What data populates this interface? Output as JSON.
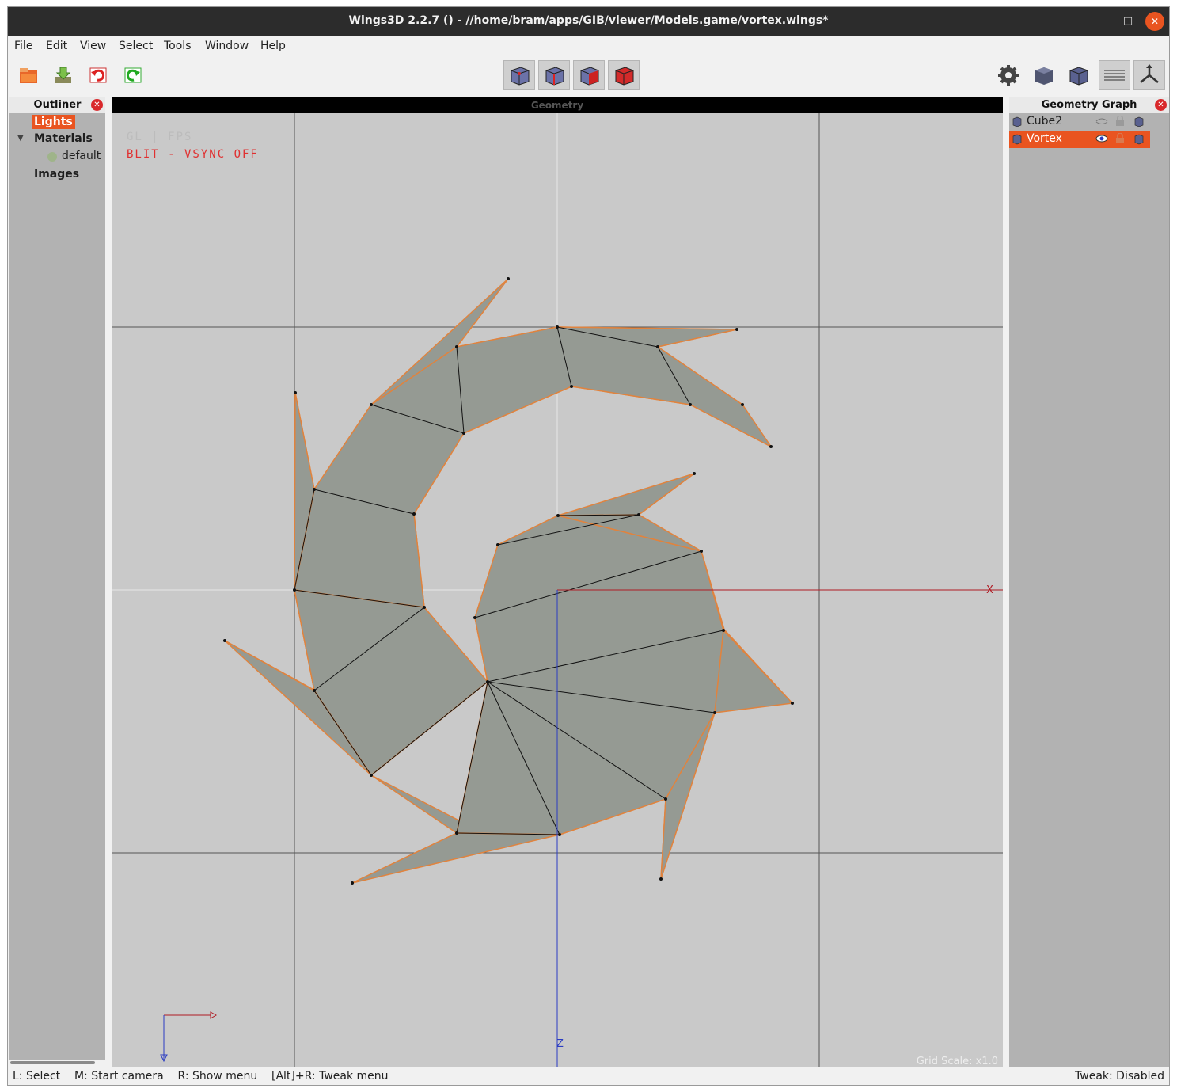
{
  "window": {
    "title": "Wings3D 2.2.7 () - //home/bram/apps/GIB/viewer/Models.game/vortex.wings*",
    "minimize_glyph": "–",
    "maximize_glyph": "□",
    "close_glyph": "✕"
  },
  "menu": [
    "File",
    "Edit",
    "View",
    "Select",
    "Tools",
    "Window",
    "Help"
  ],
  "toolbar": {
    "left_icons": [
      "open-folder-icon",
      "save-icon",
      "undo-icon",
      "redo-icon"
    ],
    "mode_icons": [
      "vertex-mode-icon",
      "edge-mode-icon",
      "face-mode-icon",
      "body-mode-icon"
    ],
    "right_icons": [
      "settings-gear-icon",
      "smooth-shading-icon",
      "flat-shading-icon",
      "groundplane-icon",
      "axes-icon"
    ]
  },
  "outliner": {
    "title": "Outliner",
    "items": [
      {
        "label": "Lights",
        "selected": true
      },
      {
        "label": "Materials",
        "expanded": true
      },
      {
        "label": "default"
      },
      {
        "label": "Images"
      }
    ]
  },
  "viewport": {
    "title": "Geometry",
    "overlay_fps": "GL | FPS",
    "overlay_blit": "BLIT - VSYNC OFF",
    "x_axis_label": "X",
    "z_axis_label": "Z",
    "grid_scale": "Grid Scale: x1.0"
  },
  "geometry_graph": {
    "title": "Geometry Graph",
    "objects": [
      {
        "name": "Cube2",
        "selected": false
      },
      {
        "name": "Vortex",
        "selected": true
      }
    ]
  },
  "statusbar": {
    "left": "L: Select    M: Start camera    R: Show menu    [Alt]+R: Tweak menu",
    "right": "Tweak: Disabled"
  },
  "colors": {
    "accent": "#e95420",
    "viewport_bg": "#c9c9c9",
    "mesh_face": "#959a93",
    "mesh_edge_outline": "#e0833e",
    "x_axis": "#b01c24",
    "z_axis": "#2a3cc2"
  }
}
